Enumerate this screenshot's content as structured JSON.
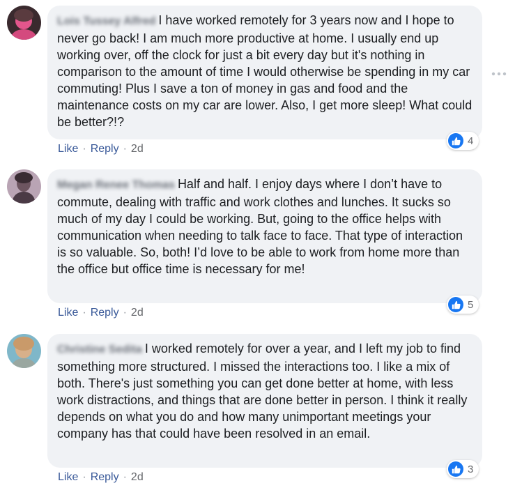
{
  "comments": [
    {
      "author": "Lois Tussey Alfred",
      "text": "I have worked remotely for 3 years now and I hope to never go back! I am much more productive at home. I usually end up working over, off the clock for just a bit every day but it's nothing in comparison to the amount of time I would otherwise be spending in my car commuting! Plus I save a ton of money in gas and food and the maintenance costs on my car are lower. Also, I get more sleep! What could be better?!?",
      "like_label": "Like",
      "reply_label": "Reply",
      "time": "2d",
      "reaction_count": "4"
    },
    {
      "author": "Megan Renee Thomas",
      "text": "Half and half. I enjoy days where I don’t have to commute, dealing with traffic and work clothes and lunches. It sucks so much of my day I could be working. But, going to the office helps with communication when needing to talk face to face. That type of interaction is so valuable. So, both! I’d love to be able to work from home more than the office but office time is necessary for me!",
      "like_label": "Like",
      "reply_label": "Reply",
      "time": "2d",
      "reaction_count": "5"
    },
    {
      "author": "Christine Sedita",
      "text": "I worked remotely for over a year, and I left my job to find something more structured. I missed the interactions too. I like a mix of both. There's just something you can get done better at home, with less work distractions, and things that are done better in person. I think it really depends on what you do and how many unimportant meetings your company has that could have been resolved in an email.",
      "like_label": "Like",
      "reply_label": "Reply",
      "time": "2d",
      "reaction_count": "3"
    }
  ],
  "separator": "·",
  "colors": {
    "bubble_bg": "#f0f2f5",
    "link": "#385898",
    "like_blue": "#1877f2",
    "meta_gray": "#65676b"
  },
  "icons": {
    "like": "thumbs-up-icon",
    "more": "more-options-icon"
  }
}
